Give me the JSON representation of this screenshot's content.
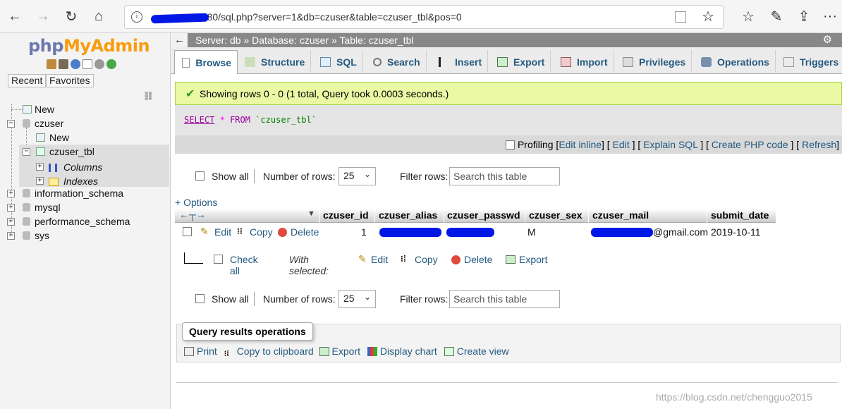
{
  "browser": {
    "url": "8080/sql.php?server=1&db=czuser&table=czuser_tbl&pos=0",
    "back_icon": "←",
    "forward_icon": "→",
    "refresh_icon": "↻",
    "home_icon": "⌂",
    "info_icon": "i",
    "star_icon": "☆",
    "fav_icon": "☆",
    "pen_icon": "✎",
    "share_icon": "⇪",
    "more_icon": "···"
  },
  "nav": {
    "logo_part1": "php",
    "logo_part2": "MyAdmin",
    "tabs": [
      "Recent",
      "Favorites"
    ],
    "tree": {
      "new": "New",
      "czuser": "czuser",
      "czuser_new": "New",
      "czuser_tbl": "czuser_tbl",
      "columns": "Columns",
      "indexes": "Indexes",
      "information_schema": "information_schema",
      "mysql": "mysql",
      "performance_schema": "performance_schema",
      "sys": "sys"
    }
  },
  "breadcrumb": {
    "server": "Server: db »",
    "database": "Database: czuser »",
    "table": "Table: czuser_tbl"
  },
  "tabs": [
    {
      "label": "Browse"
    },
    {
      "label": "Structure"
    },
    {
      "label": "SQL"
    },
    {
      "label": "Search"
    },
    {
      "label": "Insert"
    },
    {
      "label": "Export"
    },
    {
      "label": "Import"
    },
    {
      "label": "Privileges"
    },
    {
      "label": "Operations"
    },
    {
      "label": "Triggers"
    }
  ],
  "success_message": "Showing rows 0 - 0 (1 total, Query took 0.0003 seconds.)",
  "sql": {
    "select": "SELECT",
    "star": "*",
    "from": "FROM",
    "table": "`czuser_tbl`"
  },
  "sql_links": {
    "profiling": "Profiling",
    "edit_inline": "Edit inline",
    "edit": "Edit",
    "explain": "Explain SQL",
    "php_code": "Create PHP code",
    "refresh": "Refresh"
  },
  "nav_controls": {
    "show_all": "Show all",
    "rows_label": "Number of rows:",
    "rows_value": "25",
    "filter_label": "Filter rows:",
    "filter_placeholder": "Search this table"
  },
  "options_link": "+ Options",
  "columns": [
    "czuser_id",
    "czuser_alias",
    "czuser_passwd",
    "czuser_sex",
    "czuser_mail",
    "submit_date"
  ],
  "row": {
    "edit": "Edit",
    "copy": "Copy",
    "delete": "Delete",
    "czuser_id": "1",
    "czuser_sex": "M",
    "czuser_mail_visible": "@gmail.com",
    "submit_date": "2019-10-11"
  },
  "bulk": {
    "check_all": "Check all",
    "with_selected": "With selected:",
    "edit": "Edit",
    "copy": "Copy",
    "delete": "Delete",
    "export": "Export"
  },
  "query_ops": {
    "title": "Query results operations",
    "print": "Print",
    "copy": "Copy to clipboard",
    "export": "Export",
    "chart": "Display chart",
    "view": "Create view"
  },
  "watermark": "https://blog.csdn.net/chengguo2015",
  "colors": {
    "link": "#235a81",
    "success_bg": "#ebf8a4",
    "topbar": "#888888",
    "redaction": "#0018e6"
  }
}
